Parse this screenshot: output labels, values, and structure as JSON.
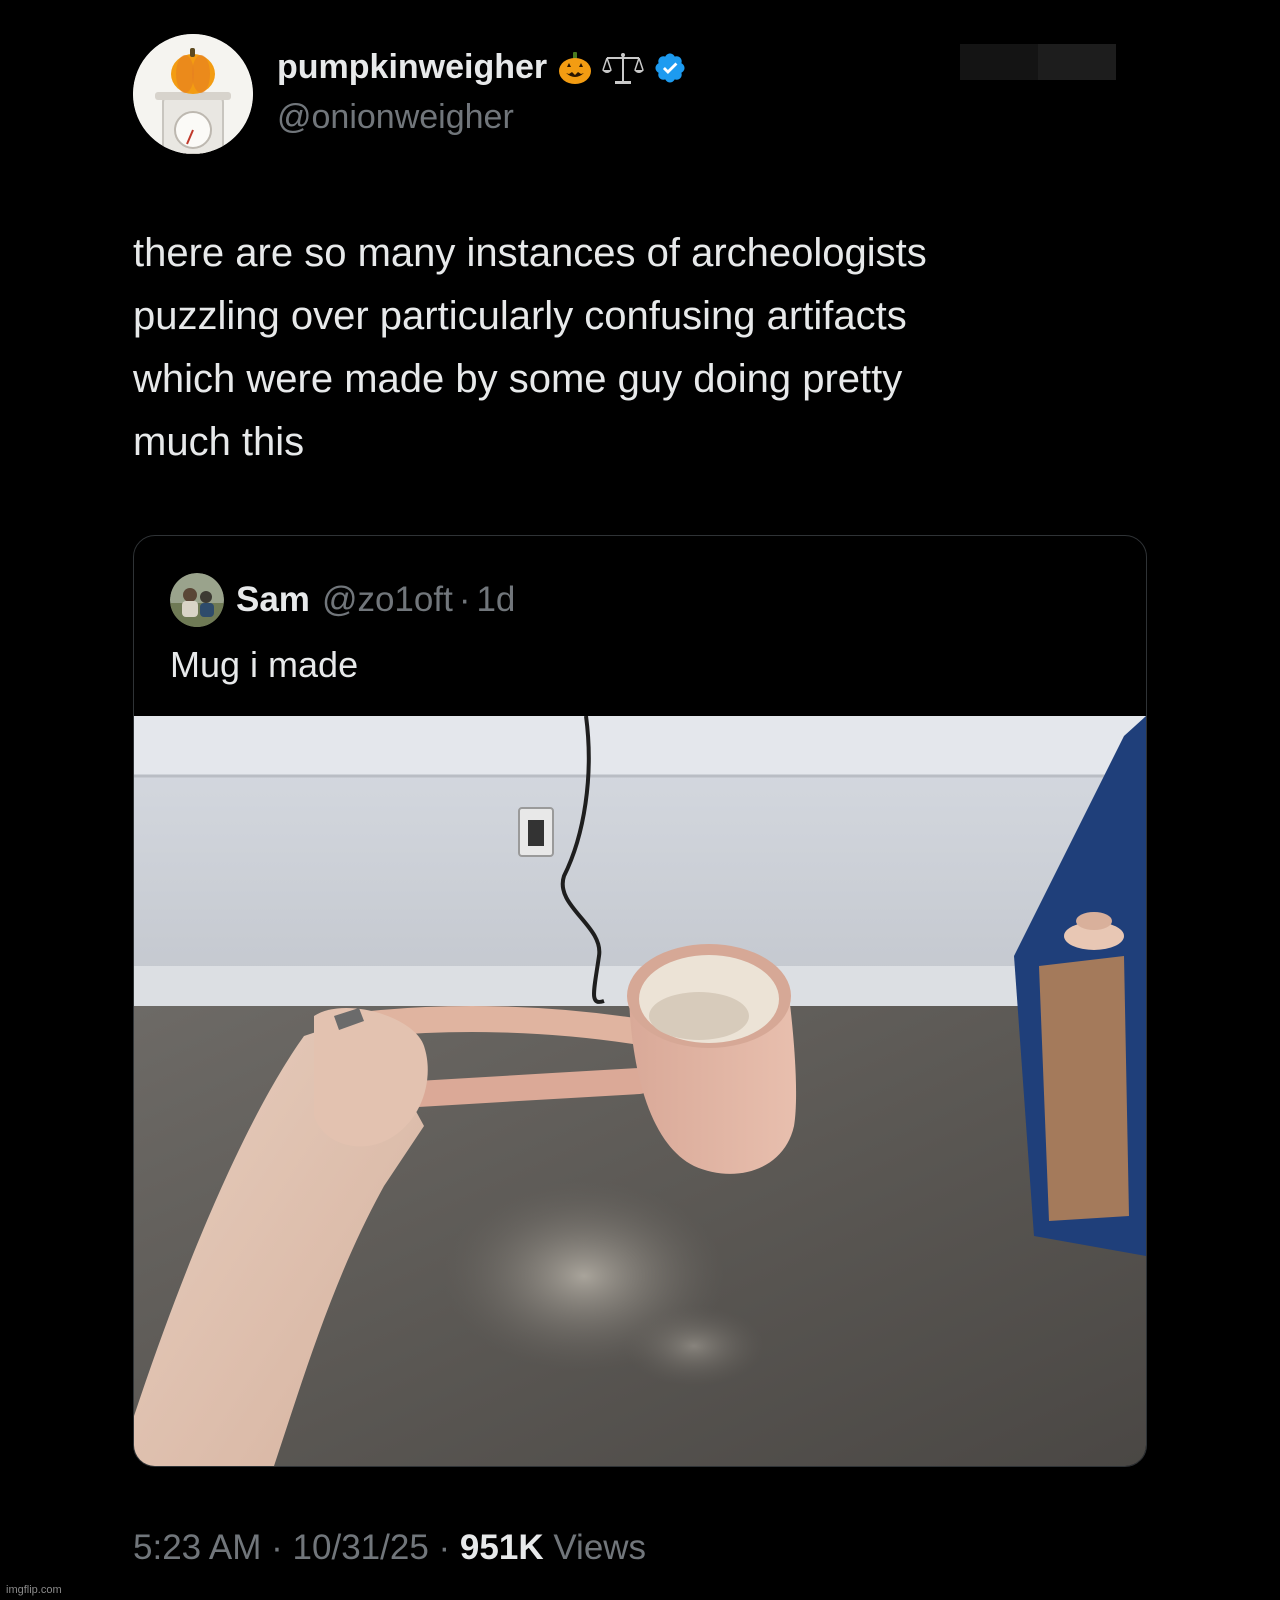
{
  "author": {
    "display_name": "pumpkinweigher",
    "handle": "@onionweigher",
    "name_icons": [
      "jack-o-lantern-icon",
      "balance-scale-icon",
      "verified-badge-icon"
    ],
    "verified_color": "#1d9bf0"
  },
  "tweet": {
    "text": "there are so many instances of archeologists\npuzzling over particularly confusing artifacts\nwhich were made by some guy doing pretty\nmuch this"
  },
  "quote": {
    "name": "Sam",
    "handle": "@zo1oft",
    "separator": "·",
    "time": "1d",
    "text": "Mug i made"
  },
  "footer": {
    "time": "5:23 AM",
    "separator": "·",
    "date": "10/31/25",
    "views_count": "951K",
    "views_label": "Views"
  },
  "watermark": "imgflip.com",
  "colors": {
    "background": "#000000",
    "text_primary": "#e7e9ea",
    "text_secondary": "#71767b",
    "border": "#2f3336"
  }
}
